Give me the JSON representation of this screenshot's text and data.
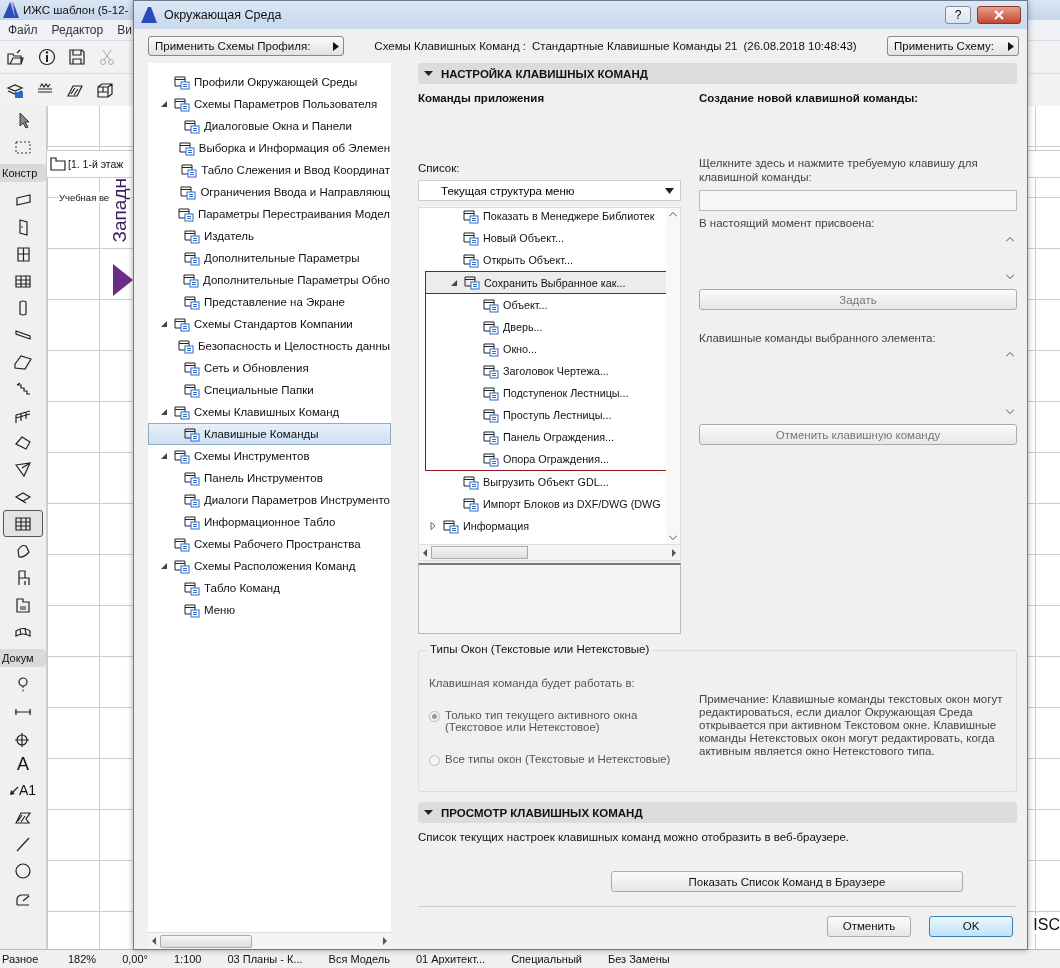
{
  "background": {
    "title": "ИЖС шаблон (5-12-",
    "menu": [
      "Файл",
      "Редактор",
      "Ви"
    ],
    "palette_labels": [
      "Констр",
      "Докум",
      "Разное"
    ],
    "construction_tools": [
      {
        "selected": false
      },
      {
        "selected": false
      },
      {
        "selected": false
      },
      {
        "selected": false
      },
      {
        "selected": false
      },
      {
        "selected": false
      },
      {
        "selected": false
      },
      {
        "selected": false
      },
      {
        "selected": false
      },
      {
        "selected": false
      },
      {
        "selected": false
      },
      {
        "selected": false
      },
      {
        "selected": true
      },
      {
        "selected": false
      },
      {
        "selected": false
      },
      {
        "selected": false
      },
      {
        "selected": false
      }
    ],
    "text_tool_glyphs": [
      "A",
      "A1"
    ],
    "view_tab": "[1. 1-й этаж",
    "canvas_label": "Учебная ве",
    "vertical_label": "Западн",
    "edge_text": "ISC",
    "status_bar": [
      "182%",
      "0,00°",
      "1:100",
      "03 Планы - К...",
      "Вся Модель",
      "01 Архитект...",
      "Специальный",
      "Без Замены"
    ]
  },
  "dialog": {
    "title": "Окружающая Среда",
    "help": "?",
    "profile_button": "Применить Схемы Профиля:",
    "scheme_label": "Схемы Клавишных Команд :",
    "scheme_name": "Стандартные Клавишные Команды 21",
    "scheme_date": "(26.08.2018 10:48:43)",
    "apply_button": "Применить Схему:",
    "tree": [
      {
        "label": "Профили Окружающей Среды",
        "selected": false
      },
      {
        "label": "Схемы Параметров Пользователя",
        "selected": false,
        "expanded": true,
        "children": [
          {
            "label": "Диалоговые Окна и Панели",
            "selected": false
          },
          {
            "label": "Выборка и Информация об Элемен",
            "selected": false
          },
          {
            "label": "Табло Слежения и Ввод Координат",
            "selected": false
          },
          {
            "label": "Ограничения Ввода и Направляющ",
            "selected": false
          },
          {
            "label": "Параметры Перестраивания Модел",
            "selected": false
          },
          {
            "label": "Издатель",
            "selected": false
          },
          {
            "label": "Дополнительные Параметры",
            "selected": false
          },
          {
            "label": "Дополнительные Параметры Обно",
            "selected": false
          },
          {
            "label": "Представление на Экране",
            "selected": false
          }
        ]
      },
      {
        "label": "Схемы Стандартов Компании",
        "selected": false,
        "expanded": true,
        "children": [
          {
            "label": "Безопасность и Целостность данны",
            "selected": false
          },
          {
            "label": "Сеть и Обновления",
            "selected": false
          },
          {
            "label": "Специальные Папки",
            "selected": false
          }
        ]
      },
      {
        "label": "Схемы Клавишных Команд",
        "selected": false,
        "expanded": true,
        "children": [
          {
            "label": "Клавишные Команды",
            "selected": true
          }
        ]
      },
      {
        "label": "Схемы Инструментов",
        "selected": false,
        "expanded": true,
        "children": [
          {
            "label": "Панель Инструментов",
            "selected": false
          },
          {
            "label": "Диалоги Параметров Инструменто",
            "selected": false
          },
          {
            "label": "Информационное Табло",
            "selected": false
          }
        ]
      },
      {
        "label": "Схемы Рабочего Пространства",
        "selected": false
      },
      {
        "label": "Схемы Расположения Команд",
        "selected": false,
        "expanded": true,
        "children": [
          {
            "label": "Табло Команд",
            "selected": false
          },
          {
            "label": "Меню",
            "selected": false
          }
        ]
      }
    ],
    "section_setup": {
      "title": "НАСТРОЙКА КЛАВИШНЫХ КОМАНД",
      "expanded": true
    },
    "commands_heading": "Команды приложения",
    "list_label": "Список:",
    "list_dropdown": "Текущая структура меню",
    "commands": [
      {
        "children": [
          {
            "label": "Показать в Менеджере Библиотек",
            "selected": false
          },
          {
            "label": "Новый Объект...",
            "selected": false
          },
          {
            "label": "Открыть Объект...",
            "selected": false
          },
          {
            "label": "Сохранить Выбранное как...",
            "selected": true,
            "expanded": true,
            "framed": true,
            "children": [
              {
                "label": "Объект...",
                "selected": false
              },
              {
                "label": "Дверь...",
                "selected": false
              },
              {
                "label": "Окно...",
                "selected": false
              },
              {
                "label": "Заголовок Чертежа...",
                "selected": false
              },
              {
                "label": "Подступенок Лестницы...",
                "selected": false
              },
              {
                "label": "Проступь Лестницы...",
                "selected": false
              },
              {
                "label": "Панель Ограждения...",
                "selected": false
              },
              {
                "label": "Опора Ограждения...",
                "selected": false
              }
            ]
          },
          {
            "label": "Выгрузить Объект GDL...",
            "selected": false
          },
          {
            "label": "Импорт Блоков из DXF/DWG (DWG",
            "selected": false
          }
        ]
      },
      {
        "label": "Информация",
        "selected": false,
        "expanded": false
      }
    ],
    "new_shortcut_heading": "Создание новой клавишной команды:",
    "shortcut_hint": "Щелкните здесь и нажмите требуемую клавишу для клавишной команды:",
    "assigned_label": "В настоящий момент присвоена:",
    "assign_button": {
      "label": "Задать",
      "disabled": true
    },
    "element_shortcuts_label": "Клавишные команды выбранного элемента:",
    "remove_button": {
      "label": "Отменить клавишную команду",
      "disabled": true
    },
    "window_types": {
      "title": "Типы Окон (Текстовые или Нетекстовые)",
      "prompt": "Клавишная команда будет работать в:",
      "disabled": true,
      "options": [
        {
          "label": "Только тип текущего активного окна (Текстовое или Нетекстовое)",
          "selected": true
        },
        {
          "label": "Все типы окон (Текстовые и Нетекстовые)",
          "selected": false
        }
      ],
      "note": "Примечание: Клавишные команды текстовых окон могут редактироваться, если диалог Окружающая Среда открывается при активном Текстовом окне. Клавишные команды Нетекстовых окон могут редактировать, когда активным является окно Нетекстового типа."
    },
    "section_view": {
      "title": "ПРОСМОТР КЛАВИШНЫХ КОМАНД",
      "expanded": true
    },
    "browser_note": "Список текущих настроек клавишных команд можно отобразить в веб-браузере.",
    "browser_button": "Показать Список Команд в Браузере",
    "cancel_button": "Отменить",
    "ok_button": "OK"
  }
}
